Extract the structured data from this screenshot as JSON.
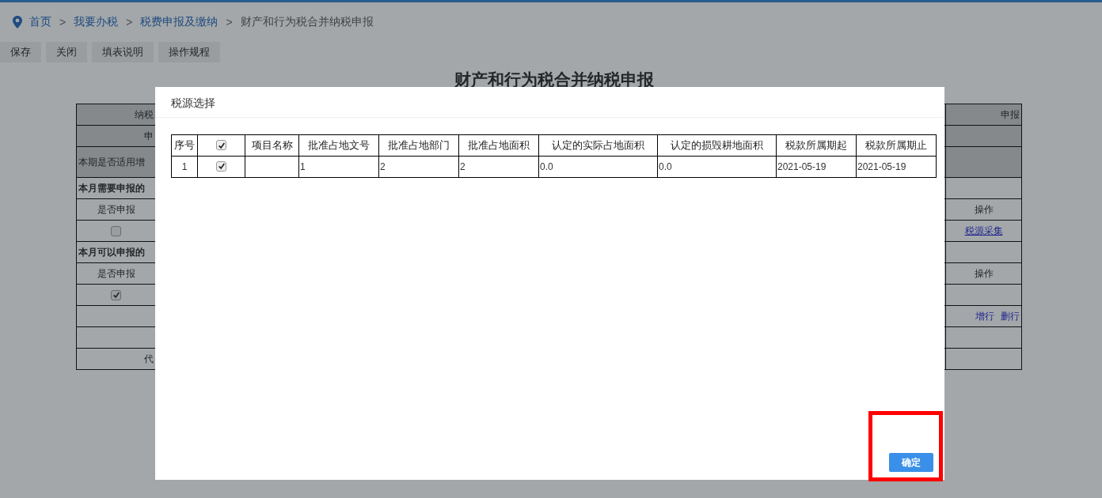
{
  "breadcrumb": [
    {
      "label": "首页",
      "link": true
    },
    {
      "label": "我要办税",
      "link": true
    },
    {
      "label": "税费申报及缴纳",
      "link": true
    },
    {
      "label": "财产和行为税合并纳税申报",
      "link": false
    }
  ],
  "breadcrumb_separator": ">",
  "toolbar": [
    "保存",
    "关闭",
    "填表说明",
    "操作规程"
  ],
  "page_title": "财产和行为税合并纳税申报",
  "form_rows": [
    {
      "shaded": true,
      "left": {
        "kind": "cut",
        "text": "纳税"
      },
      "right": {
        "kind": "cut",
        "text": "申报"
      }
    },
    {
      "shaded": true,
      "left": {
        "kind": "cut",
        "text": "申"
      }
    },
    {
      "shaded": true,
      "tall": true,
      "left": {
        "kind": "label",
        "text": "本期是否适用增"
      }
    },
    {
      "shaded": false,
      "left": {
        "kind": "heading",
        "text": "本月需要申报的"
      }
    },
    {
      "shaded": false,
      "left": {
        "kind": "center",
        "text": "是否申报"
      },
      "right": {
        "kind": "center",
        "text": "操作"
      }
    },
    {
      "shaded": false,
      "left": {
        "kind": "checkbox",
        "checked": false
      },
      "right": {
        "kind": "link",
        "text": "税源采集"
      }
    },
    {
      "shaded": false,
      "left": {
        "kind": "heading",
        "text": "本月可以申报的"
      }
    },
    {
      "shaded": false,
      "left": {
        "kind": "center",
        "text": "是否申报"
      },
      "right": {
        "kind": "center",
        "text": "操作"
      }
    },
    {
      "shaded": false,
      "left": {
        "kind": "checkbox",
        "checked": true
      }
    },
    {
      "shaded": false,
      "right": {
        "kind": "actions",
        "items": [
          "增行",
          "删行"
        ]
      }
    },
    {
      "shaded": false
    },
    {
      "shaded": false,
      "left": {
        "kind": "cut",
        "text": "代"
      }
    }
  ],
  "dialog": {
    "title": "税源选择",
    "columns": [
      {
        "kind": "text",
        "label": "序号"
      },
      {
        "kind": "checkbox",
        "checked": true
      },
      {
        "kind": "text",
        "label": "项目名称"
      },
      {
        "kind": "text",
        "label": "批准占地文号"
      },
      {
        "kind": "text",
        "label": "批准占地部门"
      },
      {
        "kind": "text",
        "label": "批准占地面积"
      },
      {
        "kind": "text",
        "label": "认定的实际占地面积"
      },
      {
        "kind": "text",
        "label": "认定的损毁耕地面积"
      },
      {
        "kind": "text",
        "label": "税款所属期起"
      },
      {
        "kind": "text",
        "label": "税款所属期止"
      }
    ],
    "rows": [
      {
        "cells": [
          "1",
          {
            "checked": true
          },
          "",
          "1",
          "2",
          "2",
          "0.0",
          "0.0",
          "2021-05-19",
          "2021-05-19"
        ]
      }
    ],
    "confirm_button": "确定"
  }
}
